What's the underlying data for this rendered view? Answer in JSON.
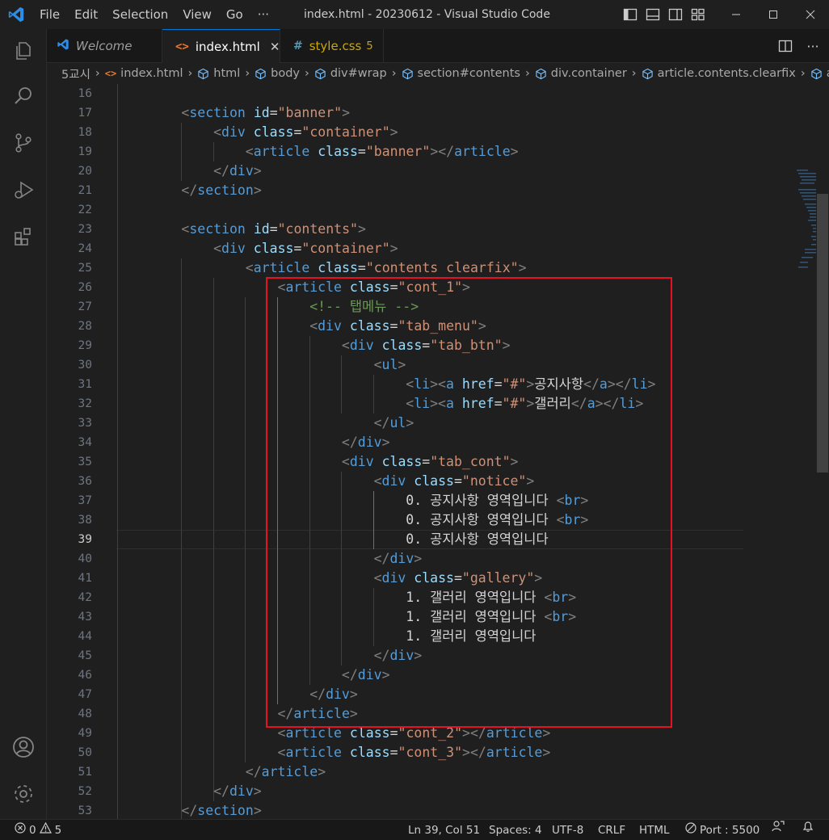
{
  "titlebar": {
    "menu": [
      "File",
      "Edit",
      "Selection",
      "View",
      "Go",
      "···"
    ],
    "title": "index.html - 20230612 - Visual Studio Code"
  },
  "activity_icons": [
    "explorer-icon",
    "search-icon",
    "source-control-icon",
    "run-debug-icon",
    "extensions-icon",
    "account-icon",
    "settings-gear-icon"
  ],
  "tabs": [
    {
      "label": "Welcome",
      "icon": "vscode-icon"
    },
    {
      "label": "index.html",
      "icon": "html-icon",
      "close": "✕"
    },
    {
      "label": "style.css",
      "icon": "css-hash-icon",
      "badge": "5"
    }
  ],
  "breadcrumb": [
    "5교시",
    "index.html",
    "html",
    "body",
    "div#wrap",
    "section#contents",
    "div.container",
    "article.contents.clearfix",
    "a"
  ],
  "editor": {
    "current_line": 39,
    "lines": [
      {
        "n": "16",
        "parts": []
      },
      {
        "n": "17",
        "parts": [
          [
            "p",
            "<"
          ],
          [
            "t",
            "section"
          ],
          [
            "x",
            " "
          ],
          [
            "a",
            "id"
          ],
          [
            "x",
            "="
          ],
          [
            "s",
            "\"banner\""
          ],
          [
            "p",
            ">"
          ]
        ]
      },
      {
        "n": "18",
        "parts": [
          [
            "p",
            "<"
          ],
          [
            "t",
            "div"
          ],
          [
            "x",
            " "
          ],
          [
            "a",
            "class"
          ],
          [
            "x",
            "="
          ],
          [
            "s",
            "\"container\""
          ],
          [
            "p",
            ">"
          ]
        ]
      },
      {
        "n": "19",
        "parts": [
          [
            "p",
            "<"
          ],
          [
            "t",
            "article"
          ],
          [
            "x",
            " "
          ],
          [
            "a",
            "class"
          ],
          [
            "x",
            "="
          ],
          [
            "s",
            "\"banner\""
          ],
          [
            "p",
            "></"
          ],
          [
            "t",
            "article"
          ],
          [
            "p",
            ">"
          ]
        ]
      },
      {
        "n": "20",
        "parts": [
          [
            "p",
            "</"
          ],
          [
            "t",
            "div"
          ],
          [
            "p",
            ">"
          ]
        ]
      },
      {
        "n": "21",
        "parts": [
          [
            "p",
            "</"
          ],
          [
            "t",
            "section"
          ],
          [
            "p",
            ">"
          ]
        ]
      },
      {
        "n": "22",
        "parts": []
      },
      {
        "n": "23",
        "parts": [
          [
            "p",
            "<"
          ],
          [
            "t",
            "section"
          ],
          [
            "x",
            " "
          ],
          [
            "a",
            "id"
          ],
          [
            "x",
            "="
          ],
          [
            "s",
            "\"contents\""
          ],
          [
            "p",
            ">"
          ]
        ]
      },
      {
        "n": "24",
        "parts": [
          [
            "p",
            "<"
          ],
          [
            "t",
            "div"
          ],
          [
            "x",
            " "
          ],
          [
            "a",
            "class"
          ],
          [
            "x",
            "="
          ],
          [
            "s",
            "\"container\""
          ],
          [
            "p",
            ">"
          ]
        ]
      },
      {
        "n": "25",
        "parts": [
          [
            "p",
            "<"
          ],
          [
            "t",
            "article"
          ],
          [
            "x",
            " "
          ],
          [
            "a",
            "class"
          ],
          [
            "x",
            "="
          ],
          [
            "s",
            "\"contents clearfix\""
          ],
          [
            "p",
            ">"
          ]
        ]
      },
      {
        "n": "26",
        "parts": [
          [
            "p",
            "<"
          ],
          [
            "t",
            "article"
          ],
          [
            "x",
            " "
          ],
          [
            "a",
            "class"
          ],
          [
            "x",
            "="
          ],
          [
            "s",
            "\"cont_1\""
          ],
          [
            "p",
            ">"
          ]
        ]
      },
      {
        "n": "27",
        "parts": [
          [
            "c",
            "<!-- 탭메뉴 -->"
          ]
        ]
      },
      {
        "n": "28",
        "parts": [
          [
            "p",
            "<"
          ],
          [
            "t",
            "div"
          ],
          [
            "x",
            " "
          ],
          [
            "a",
            "class"
          ],
          [
            "x",
            "="
          ],
          [
            "s",
            "\"tab_menu\""
          ],
          [
            "p",
            ">"
          ]
        ]
      },
      {
        "n": "29",
        "parts": [
          [
            "p",
            "<"
          ],
          [
            "t",
            "div"
          ],
          [
            "x",
            " "
          ],
          [
            "a",
            "class"
          ],
          [
            "x",
            "="
          ],
          [
            "s",
            "\"tab_btn\""
          ],
          [
            "p",
            ">"
          ]
        ]
      },
      {
        "n": "30",
        "parts": [
          [
            "p",
            "<"
          ],
          [
            "t",
            "ul"
          ],
          [
            "p",
            ">"
          ]
        ]
      },
      {
        "n": "31",
        "parts": [
          [
            "p",
            "<"
          ],
          [
            "t",
            "li"
          ],
          [
            "p",
            "><"
          ],
          [
            "t",
            "a"
          ],
          [
            "x",
            " "
          ],
          [
            "a",
            "href"
          ],
          [
            "x",
            "="
          ],
          [
            "s",
            "\"#\""
          ],
          [
            "p",
            ">"
          ],
          [
            "x",
            "공지사항"
          ],
          [
            "p",
            "</"
          ],
          [
            "t",
            "a"
          ],
          [
            "p",
            "></"
          ],
          [
            "t",
            "li"
          ],
          [
            "p",
            ">"
          ]
        ]
      },
      {
        "n": "32",
        "parts": [
          [
            "p",
            "<"
          ],
          [
            "t",
            "li"
          ],
          [
            "p",
            "><"
          ],
          [
            "t",
            "a"
          ],
          [
            "x",
            " "
          ],
          [
            "a",
            "href"
          ],
          [
            "x",
            "="
          ],
          [
            "s",
            "\"#\""
          ],
          [
            "p",
            ">"
          ],
          [
            "x",
            "갤러리"
          ],
          [
            "p",
            "</"
          ],
          [
            "t",
            "a"
          ],
          [
            "p",
            "></"
          ],
          [
            "t",
            "li"
          ],
          [
            "p",
            ">"
          ]
        ]
      },
      {
        "n": "33",
        "parts": [
          [
            "p",
            "</"
          ],
          [
            "t",
            "ul"
          ],
          [
            "p",
            ">"
          ]
        ]
      },
      {
        "n": "34",
        "parts": [
          [
            "p",
            "</"
          ],
          [
            "t",
            "div"
          ],
          [
            "p",
            ">"
          ]
        ]
      },
      {
        "n": "35",
        "parts": [
          [
            "p",
            "<"
          ],
          [
            "t",
            "div"
          ],
          [
            "x",
            " "
          ],
          [
            "a",
            "class"
          ],
          [
            "x",
            "="
          ],
          [
            "s",
            "\"tab_cont\""
          ],
          [
            "p",
            ">"
          ]
        ]
      },
      {
        "n": "36",
        "parts": [
          [
            "p",
            "<"
          ],
          [
            "t",
            "div"
          ],
          [
            "x",
            " "
          ],
          [
            "a",
            "class"
          ],
          [
            "x",
            "="
          ],
          [
            "s",
            "\"notice\""
          ],
          [
            "p",
            ">"
          ]
        ]
      },
      {
        "n": "37",
        "parts": [
          [
            "x",
            "0. 공지사항 영역입니다 "
          ],
          [
            "p",
            "<"
          ],
          [
            "t",
            "br"
          ],
          [
            "p",
            ">"
          ]
        ]
      },
      {
        "n": "38",
        "parts": [
          [
            "x",
            "0. 공지사항 영역입니다 "
          ],
          [
            "p",
            "<"
          ],
          [
            "t",
            "br"
          ],
          [
            "p",
            ">"
          ]
        ]
      },
      {
        "n": "39",
        "parts": [
          [
            "x",
            "0. 공지사항 영역입니다"
          ]
        ]
      },
      {
        "n": "40",
        "parts": [
          [
            "p",
            "</"
          ],
          [
            "t",
            "div"
          ],
          [
            "p",
            ">"
          ]
        ]
      },
      {
        "n": "41",
        "parts": [
          [
            "p",
            "<"
          ],
          [
            "t",
            "div"
          ],
          [
            "x",
            " "
          ],
          [
            "a",
            "class"
          ],
          [
            "x",
            "="
          ],
          [
            "s",
            "\"gallery\""
          ],
          [
            "p",
            ">"
          ]
        ]
      },
      {
        "n": "42",
        "parts": [
          [
            "x",
            "1. 갤러리 영역입니다 "
          ],
          [
            "p",
            "<"
          ],
          [
            "t",
            "br"
          ],
          [
            "p",
            ">"
          ]
        ]
      },
      {
        "n": "43",
        "parts": [
          [
            "x",
            "1. 갤러리 영역입니다 "
          ],
          [
            "p",
            "<"
          ],
          [
            "t",
            "br"
          ],
          [
            "p",
            ">"
          ]
        ]
      },
      {
        "n": "44",
        "parts": [
          [
            "x",
            "1. 갤러리 영역입니다"
          ]
        ]
      },
      {
        "n": "45",
        "parts": [
          [
            "p",
            "</"
          ],
          [
            "t",
            "div"
          ],
          [
            "p",
            ">"
          ]
        ]
      },
      {
        "n": "46",
        "parts": [
          [
            "p",
            "</"
          ],
          [
            "t",
            "div"
          ],
          [
            "p",
            ">"
          ]
        ]
      },
      {
        "n": "47",
        "parts": [
          [
            "p",
            "</"
          ],
          [
            "t",
            "div"
          ],
          [
            "p",
            ">"
          ]
        ]
      },
      {
        "n": "48",
        "parts": [
          [
            "p",
            "</"
          ],
          [
            "t",
            "article"
          ],
          [
            "p",
            ">"
          ]
        ]
      },
      {
        "n": "49",
        "parts": [
          [
            "p",
            "<"
          ],
          [
            "t",
            "article"
          ],
          [
            "x",
            " "
          ],
          [
            "a",
            "class"
          ],
          [
            "x",
            "="
          ],
          [
            "s",
            "\"cont_2\""
          ],
          [
            "p",
            "></"
          ],
          [
            "t",
            "article"
          ],
          [
            "p",
            ">"
          ]
        ]
      },
      {
        "n": "50",
        "parts": [
          [
            "p",
            "<"
          ],
          [
            "t",
            "article"
          ],
          [
            "x",
            " "
          ],
          [
            "a",
            "class"
          ],
          [
            "x",
            "="
          ],
          [
            "s",
            "\"cont_3\""
          ],
          [
            "p",
            "></"
          ],
          [
            "t",
            "article"
          ],
          [
            "p",
            ">"
          ]
        ]
      },
      {
        "n": "51",
        "parts": [
          [
            "p",
            "</"
          ],
          [
            "t",
            "article"
          ],
          [
            "p",
            ">"
          ]
        ]
      },
      {
        "n": "52",
        "parts": [
          [
            "p",
            "</"
          ],
          [
            "t",
            "div"
          ],
          [
            "p",
            ">"
          ]
        ]
      },
      {
        "n": "53",
        "parts": [
          [
            "p",
            "</"
          ],
          [
            "t",
            "section"
          ],
          [
            "p",
            ">"
          ]
        ]
      }
    ]
  },
  "statusbar": {
    "errors": "0",
    "warnings": "5",
    "position": "Ln 39, Col 51",
    "spaces": "Spaces: 4",
    "encoding": "UTF-8",
    "eol": "CRLF",
    "language": "HTML",
    "port": "Port : 5500"
  },
  "colors": {
    "accent": "#0078d4",
    "highlight_box": "#e81123",
    "warning": "#cca700"
  }
}
